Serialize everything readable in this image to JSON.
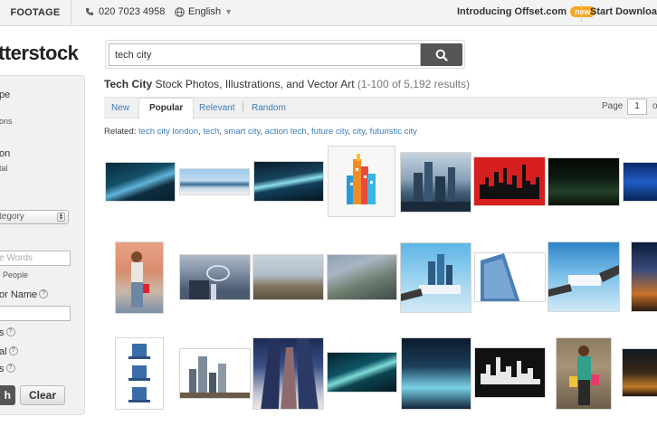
{
  "topbar": {
    "footage": "FOOTAGE",
    "phone": "020 7023 4958",
    "language": "English",
    "offset_label": "Introducing Offset.com",
    "offset_badge": "new",
    "download": "Start Downloadin"
  },
  "logo": "tterstock",
  "sidebar": {
    "t1": "pe",
    "t2": "ons",
    "t3": "on",
    "t4": "tal",
    "category_select": "tegory",
    "exclude_placeholder": "e Words",
    "people_label": "People",
    "contributor_label": "or Name",
    "q1": "s",
    "q2": "al",
    "q3": "s",
    "search_button": "h",
    "clear_button": "Clear"
  },
  "search": {
    "value": "tech city"
  },
  "heading": {
    "title": "Tech City",
    "subtitle": "Stock Photos, Illustrations, and Vector Art",
    "count": "(1-100 of 5,192 results)"
  },
  "tabs": [
    {
      "label": "New"
    },
    {
      "label": "Popular"
    },
    {
      "label": "Relevant"
    },
    {
      "label": "Random"
    }
  ],
  "pagination": {
    "label": "Page",
    "value": "1",
    "of": "o"
  },
  "related": {
    "label": "Related:",
    "links": [
      "tech city london",
      "tech",
      "smart city",
      "action tech",
      "future city",
      "city",
      "futuristic city"
    ]
  },
  "colors": {
    "link": "#3a7bb8",
    "badge": "#f5a623",
    "search_button": "#555555"
  }
}
